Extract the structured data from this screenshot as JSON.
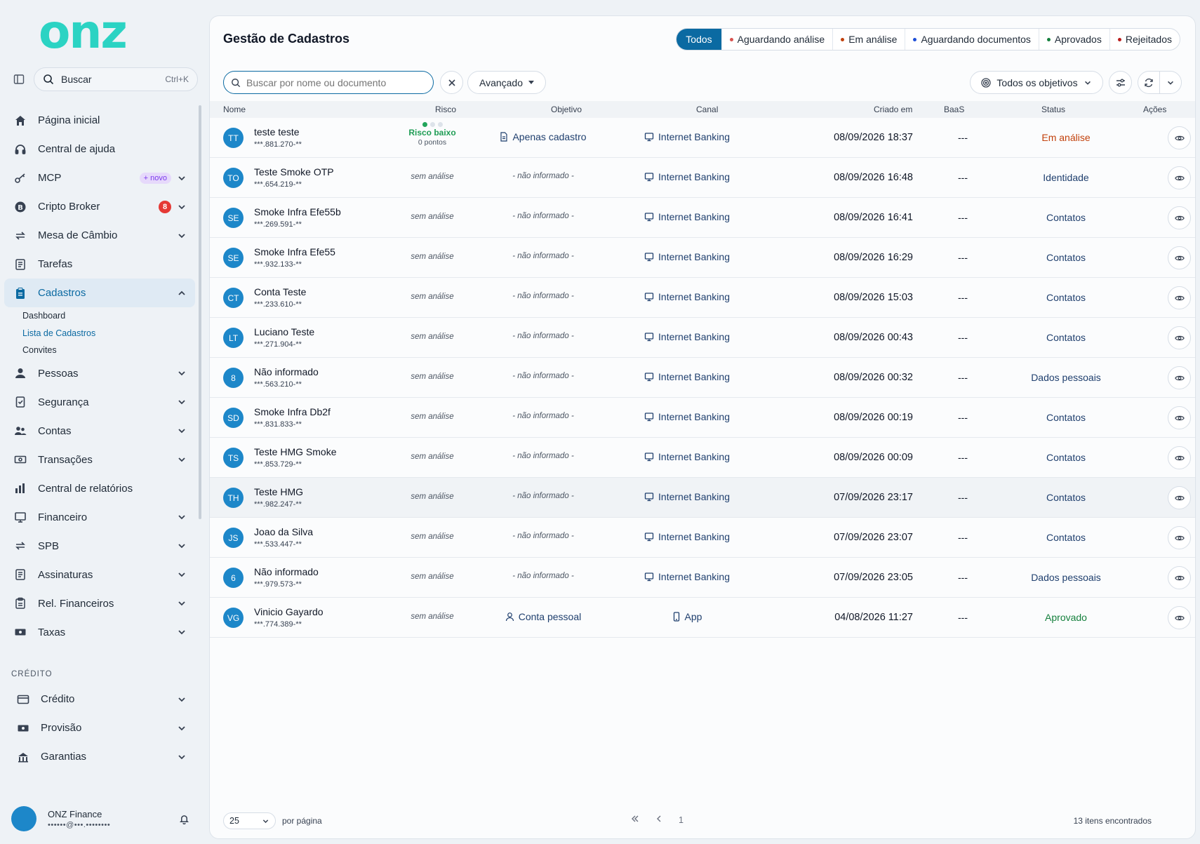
{
  "sidebar": {
    "logo_text": "onz",
    "search_label": "Buscar",
    "search_shortcut": "Ctrl+K",
    "items": [
      {
        "label": "Página inicial"
      },
      {
        "label": "Central de ajuda"
      },
      {
        "label": "MCP",
        "badge": "+ novo"
      },
      {
        "label": "Cripto Broker",
        "badge": "8"
      },
      {
        "label": "Mesa de Câmbio"
      },
      {
        "label": "Tarefas"
      },
      {
        "label": "Cadastros"
      },
      {
        "label": "Pessoas"
      },
      {
        "label": "Segurança"
      },
      {
        "label": "Contas"
      },
      {
        "label": "Transações"
      },
      {
        "label": "Central de relatórios"
      },
      {
        "label": "Financeiro"
      },
      {
        "label": "SPB"
      },
      {
        "label": "Assinaturas"
      },
      {
        "label": "Rel. Financeiros"
      },
      {
        "label": "Taxas"
      }
    ],
    "cadastros_sub": [
      "Dashboard",
      "Lista de Cadastros",
      "Convites"
    ],
    "section_credit": "CRÉDITO",
    "credit_items": [
      {
        "label": "Crédito"
      },
      {
        "label": "Provisão"
      },
      {
        "label": "Garantias"
      }
    ],
    "user": {
      "name": "ONZ Finance",
      "email": "••••••@•••.••••••••"
    }
  },
  "header": {
    "title": "Gestão de Cadastros",
    "filters": [
      {
        "label": "Todos"
      },
      {
        "label": "Aguardando análise",
        "color": "#d9534f"
      },
      {
        "label": "Em análise",
        "color": "#c2410c"
      },
      {
        "label": "Aguardando documentos",
        "color": "#1d4ed8"
      },
      {
        "label": "Aprovados",
        "color": "#15803d"
      },
      {
        "label": "Rejeitados",
        "color": "#b91c1c"
      }
    ]
  },
  "toolbar": {
    "search_placeholder": "Buscar por nome ou documento",
    "advanced_label": "Avançado",
    "objectives_label": "Todos os objetivos"
  },
  "table": {
    "columns": [
      "Nome",
      "Risco",
      "Objetivo",
      "Canal",
      "Criado em",
      "BaaS",
      "Status",
      "Ações"
    ],
    "risk_default": "sem análise",
    "objective_default": "- não informado -",
    "baas_default": "---",
    "rows": [
      {
        "initials": "TT",
        "name": "teste teste",
        "doc": "***.881.270-**",
        "risk_label": "Risco baixo",
        "risk_points": "0 pontos",
        "objective": "Apenas cadastro",
        "channel": "Internet Banking",
        "created": "08/09/2026 18:37",
        "status": "Em análise",
        "status_color": "#c2410c"
      },
      {
        "initials": "TO",
        "name": "Teste Smoke OTP",
        "doc": "***.654.219-**",
        "channel": "Internet Banking",
        "created": "08/09/2026 16:48",
        "status": "Identidade",
        "status_color": "#1f3f6e"
      },
      {
        "initials": "SE",
        "name": "Smoke Infra Efe55b",
        "doc": "***.269.591-**",
        "channel": "Internet Banking",
        "created": "08/09/2026 16:41",
        "status": "Contatos",
        "status_color": "#1f3f6e"
      },
      {
        "initials": "SE",
        "name": "Smoke Infra Efe55",
        "doc": "***.932.133-**",
        "channel": "Internet Banking",
        "created": "08/09/2026 16:29",
        "status": "Contatos",
        "status_color": "#1f3f6e"
      },
      {
        "initials": "CT",
        "name": "Conta Teste",
        "doc": "***.233.610-**",
        "channel": "Internet Banking",
        "created": "08/09/2026 15:03",
        "status": "Contatos",
        "status_color": "#1f3f6e"
      },
      {
        "initials": "LT",
        "name": "Luciano Teste",
        "doc": "***.271.904-**",
        "channel": "Internet Banking",
        "created": "08/09/2026 00:43",
        "status": "Contatos",
        "status_color": "#1f3f6e"
      },
      {
        "initials": "8",
        "name": "Não informado",
        "doc": "***.563.210-**",
        "channel": "Internet Banking",
        "created": "08/09/2026 00:32",
        "status": "Dados pessoais",
        "status_color": "#1f3f6e"
      },
      {
        "initials": "SD",
        "name": "Smoke Infra Db2f",
        "doc": "***.831.833-**",
        "channel": "Internet Banking",
        "created": "08/09/2026 00:19",
        "status": "Contatos",
        "status_color": "#1f3f6e"
      },
      {
        "initials": "TS",
        "name": "Teste HMG Smoke",
        "doc": "***.853.729-**",
        "channel": "Internet Banking",
        "created": "08/09/2026 00:09",
        "status": "Contatos",
        "status_color": "#1f3f6e"
      },
      {
        "initials": "TH",
        "name": "Teste HMG",
        "doc": "***.982.247-**",
        "channel": "Internet Banking",
        "created": "07/09/2026 23:17",
        "status": "Contatos",
        "status_color": "#1f3f6e"
      },
      {
        "initials": "JS",
        "name": "Joao da Silva",
        "doc": "***.533.447-**",
        "channel": "Internet Banking",
        "created": "07/09/2026 23:07",
        "status": "Contatos",
        "status_color": "#1f3f6e"
      },
      {
        "initials": "6",
        "name": "Não informado",
        "doc": "***.979.573-**",
        "channel": "Internet Banking",
        "created": "07/09/2026 23:05",
        "status": "Dados pessoais",
        "status_color": "#1f3f6e"
      },
      {
        "initials": "VG",
        "name": "Vinicio Gayardo",
        "doc": "***.774.389-**",
        "objective": "Conta pessoal",
        "channel": "App",
        "created": "04/08/2026 11:27",
        "status": "Aprovado",
        "status_color": "#15803d"
      }
    ]
  },
  "footer": {
    "per_page_value": "25",
    "per_page_label": "por página",
    "current_page": "1",
    "total_label": "13 itens encontrados"
  }
}
